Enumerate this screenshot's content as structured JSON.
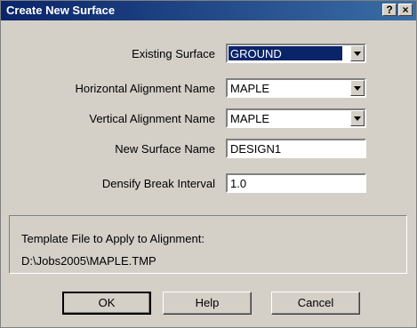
{
  "window": {
    "title": "Create New Surface",
    "help_button": "?",
    "close_button": "×"
  },
  "form": {
    "existing_surface": {
      "label": "Existing Surface",
      "value": "GROUND"
    },
    "horizontal_alignment": {
      "label": "Horizontal Alignment Name",
      "value": "MAPLE"
    },
    "vertical_alignment": {
      "label": "Vertical Alignment Name",
      "value": "MAPLE"
    },
    "new_surface_name": {
      "label": "New Surface Name",
      "value": "DESIGN1"
    },
    "densify_break_interval": {
      "label": "Densify Break Interval",
      "value": "1.0"
    }
  },
  "template": {
    "label": "Template File to Apply to Alignment:",
    "path": "D:\\Jobs2005\\MAPLE.TMP"
  },
  "buttons": {
    "ok": "OK",
    "help": "Help",
    "cancel": "Cancel"
  }
}
